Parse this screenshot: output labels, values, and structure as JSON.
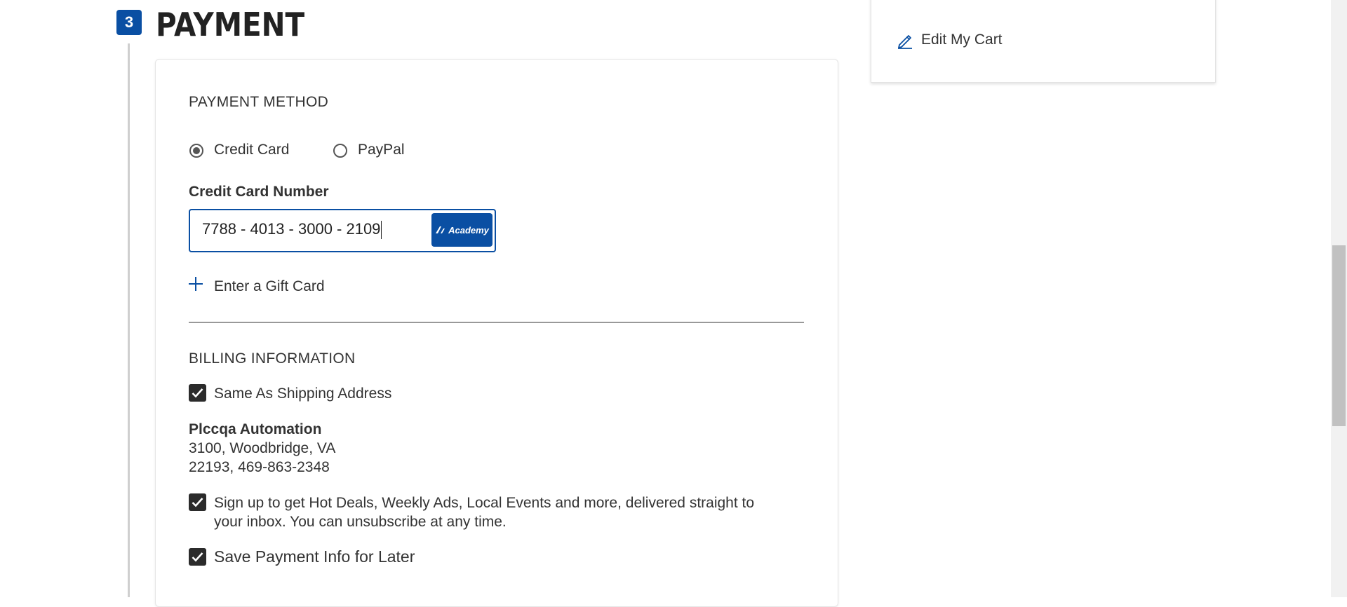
{
  "step": {
    "number": "3",
    "title": "PAYMENT"
  },
  "payment_method": {
    "heading": "PAYMENT METHOD",
    "options": [
      {
        "label": "Credit Card",
        "selected": true
      },
      {
        "label": "PayPal",
        "selected": false
      }
    ],
    "card_number_label": "Credit Card Number",
    "card_number_value": "7788 - 4013 - 3000 - 2109",
    "card_logo_text": "Academy",
    "gift_card_label": "Enter a Gift Card"
  },
  "billing": {
    "heading": "BILLING INFORMATION",
    "same_as_shipping_label": "Same As Shipping Address",
    "same_as_shipping_checked": true,
    "address": {
      "name": "Plccqa Automation",
      "line1": "3100, Woodbridge, VA",
      "line2": "22193, 469-863-2348"
    },
    "signup_line1": "Sign up to get Hot Deals, Weekly Ads, Local Events and more, delivered straight to",
    "signup_line2": "your inbox. You can unsubscribe at any time.",
    "signup_checked": true,
    "save_payment_label": "Save Payment Info for Later",
    "save_payment_checked": true
  },
  "cart": {
    "edit_label": "Edit My Cart"
  },
  "colors": {
    "accent": "#0a4fa3",
    "checkbox": "#2b2b2b",
    "divider": "#999999"
  },
  "icons": {
    "plus": "plus-icon",
    "edit": "pencil-icon",
    "check": "checkmark-icon"
  }
}
